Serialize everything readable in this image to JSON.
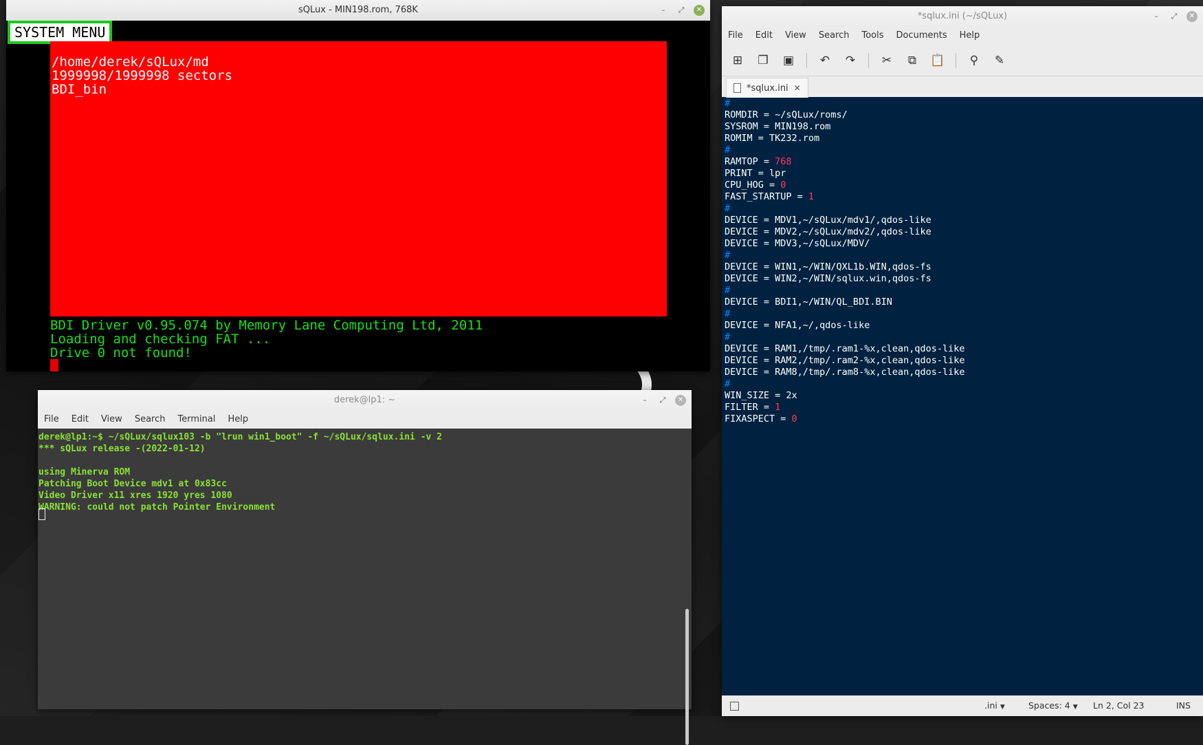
{
  "sqlux_window": {
    "title": "sQLux - MIN198.rom, 768K",
    "system_menu_label": "SYSTEM MENU",
    "red_area_lines": "/home/derek/sQLux/md\n1999998/1999998 sectors\nBDI_bin",
    "green_lines": "BDI Driver v0.95.074 by Memory Lane Computing Ltd, 2011\nLoading and checking FAT ...\nDrive 0 not found!",
    "colors": {
      "red_area": "#ff0000",
      "green_text": "#18e018",
      "system_menu_border": "#1ec81e"
    }
  },
  "terminal_window": {
    "title": "derek@lp1: ~",
    "menu": [
      "File",
      "Edit",
      "View",
      "Search",
      "Terminal",
      "Help"
    ],
    "output": "derek@lp1:~$ ~/sQLux/sqlux103 -b \"lrun win1_boot\" -f ~/sQLux/sqlux.ini -v 2\n*** sQLux release -(2022-01-12)\n\nusing Minerva ROM\nPatching Boot Device mdv1 at 0x83cc\nVideo Driver x11 xres 1920 yres 1080\nWARNING: could not patch Pointer Environment",
    "text_color": "#8ae234"
  },
  "editor_window": {
    "title": "*sqlux.ini (~/sQLux)",
    "menu": [
      "File",
      "Edit",
      "View",
      "Search",
      "Tools",
      "Documents",
      "Help"
    ],
    "toolbar_icons": [
      "new-document-icon",
      "open-document-icon",
      "save-icon",
      "undo-icon",
      "redo-icon",
      "cut-icon",
      "copy-icon",
      "paste-icon",
      "search-icon",
      "replace-icon"
    ],
    "tab_label": "*sqlux.ini",
    "code_lines": [
      [
        {
          "t": "#",
          "c": "comment"
        }
      ],
      [
        {
          "t": "ROMDIR = ~/sQLux/roms/"
        }
      ],
      [
        {
          "t": "SYSROM = MIN198.rom"
        }
      ],
      [
        {
          "t": "ROMIM = TK232.rom"
        }
      ],
      [
        {
          "t": "#",
          "c": "comment"
        }
      ],
      [
        {
          "t": "RAMTOP = "
        },
        {
          "t": "768",
          "c": "num"
        }
      ],
      [
        {
          "t": "PRINT = lpr"
        }
      ],
      [
        {
          "t": "CPU_HOG = "
        },
        {
          "t": "0",
          "c": "num"
        }
      ],
      [
        {
          "t": "FAST_STARTUP = "
        },
        {
          "t": "1",
          "c": "num"
        }
      ],
      [
        {
          "t": "#",
          "c": "comment"
        }
      ],
      [
        {
          "t": "DEVICE = MDV1,~/sQLux/mdv1/,qdos-like"
        }
      ],
      [
        {
          "t": "DEVICE = MDV2,~/sQLux/mdv2/,qdos-like"
        }
      ],
      [
        {
          "t": "DEVICE = MDV3,~/sQLux/MDV/"
        }
      ],
      [
        {
          "t": "#",
          "c": "comment"
        }
      ],
      [
        {
          "t": "DEVICE = WIN1,~/WIN/QXL1b.WIN,qdos-fs"
        }
      ],
      [
        {
          "t": "DEVICE = WIN2,~/WIN/sqlux.win,qdos-fs"
        }
      ],
      [
        {
          "t": "#",
          "c": "comment"
        }
      ],
      [
        {
          "t": "DEVICE = BDI1,~/WIN/QL_BDI.BIN"
        }
      ],
      [
        {
          "t": "#",
          "c": "comment"
        }
      ],
      [
        {
          "t": "DEVICE = NFA1,~/,qdos-like"
        }
      ],
      [
        {
          "t": "#",
          "c": "comment"
        }
      ],
      [
        {
          "t": "DEVICE = RAM1,/tmp/.ram1-%x,clean,qdos-like"
        }
      ],
      [
        {
          "t": "DEVICE = RAM2,/tmp/.ram2-%x,clean,qdos-like"
        }
      ],
      [
        {
          "t": "DEVICE = RAM8,/tmp/.ram8-%x,clean,qdos-like"
        }
      ],
      [
        {
          "t": "#",
          "c": "comment"
        }
      ],
      [
        {
          "t": "WIN_SIZE = 2x"
        }
      ],
      [
        {
          "t": "FILTER = "
        },
        {
          "t": "1",
          "c": "num"
        }
      ],
      [
        {
          "t": "FIXASPECT = "
        },
        {
          "t": "0",
          "c": "num"
        }
      ]
    ],
    "colors": {
      "background": "#002240",
      "comment": "#0088ff",
      "number": "#ff3a5a"
    },
    "status": {
      "language": ".ini",
      "indent": "Spaces: 4",
      "position": "Ln 2, Col 23",
      "mode": "INS"
    }
  }
}
